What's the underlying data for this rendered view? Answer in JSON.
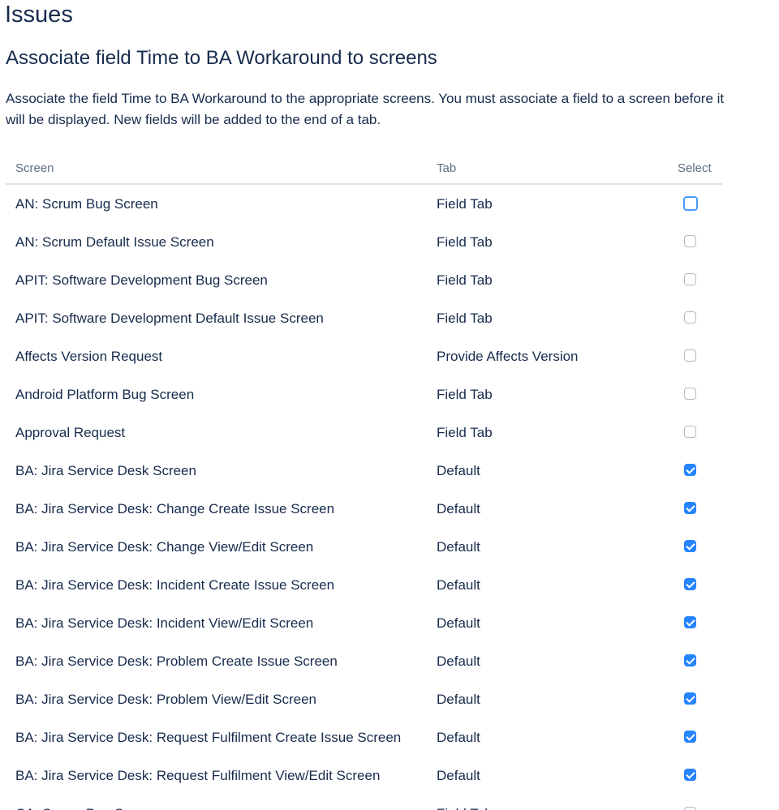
{
  "page": {
    "title": "Issues",
    "subtitle": "Associate field Time to BA Workaround to screens",
    "description": "Associate the field Time to BA Workaround to the appropriate screens. You must associate a field to a screen before it will be displayed. New fields will be added to the end of a tab."
  },
  "table": {
    "headers": {
      "screen": "Screen",
      "tab": "Tab",
      "select": "Select"
    },
    "rows": [
      {
        "screen": "AN: Scrum Bug Screen",
        "tab": "Field Tab",
        "checked": false,
        "focused": true
      },
      {
        "screen": "AN: Scrum Default Issue Screen",
        "tab": "Field Tab",
        "checked": false
      },
      {
        "screen": "APIT: Software Development Bug Screen",
        "tab": "Field Tab",
        "checked": false
      },
      {
        "screen": "APIT: Software Development Default Issue Screen",
        "tab": "Field Tab",
        "checked": false
      },
      {
        "screen": "Affects Version Request",
        "tab": "Provide Affects Version",
        "checked": false
      },
      {
        "screen": "Android Platform Bug Screen",
        "tab": "Field Tab",
        "checked": false
      },
      {
        "screen": "Approval Request",
        "tab": "Field Tab",
        "checked": false
      },
      {
        "screen": "BA: Jira Service Desk Screen",
        "tab": "Default",
        "checked": true
      },
      {
        "screen": "BA: Jira Service Desk: Change Create Issue Screen",
        "tab": "Default",
        "checked": true
      },
      {
        "screen": "BA: Jira Service Desk: Change View/Edit Screen",
        "tab": "Default",
        "checked": true
      },
      {
        "screen": "BA: Jira Service Desk: Incident Create Issue Screen",
        "tab": "Default",
        "checked": true
      },
      {
        "screen": "BA: Jira Service Desk: Incident View/Edit Screen",
        "tab": "Default",
        "checked": true
      },
      {
        "screen": "BA: Jira Service Desk: Problem Create Issue Screen",
        "tab": "Default",
        "checked": true
      },
      {
        "screen": "BA: Jira Service Desk: Problem View/Edit Screen",
        "tab": "Default",
        "checked": true
      },
      {
        "screen": "BA: Jira Service Desk: Request Fulfilment Create Issue Screen",
        "tab": "Default",
        "checked": true
      },
      {
        "screen": "BA: Jira Service Desk: Request Fulfilment View/Edit Screen",
        "tab": "Default",
        "checked": true
      },
      {
        "screen": "CA: Scrum Bug Screen",
        "tab": "Field Tab",
        "checked": false
      }
    ]
  },
  "colors": {
    "text": "#172b4d",
    "header_text": "#5e6c84",
    "checkbox_checked": "#2684ff",
    "focus_ring": "#4c9aff"
  }
}
